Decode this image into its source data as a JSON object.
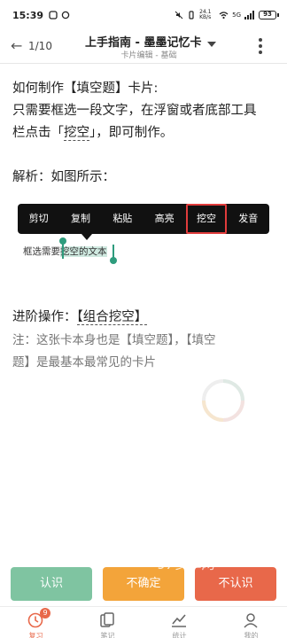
{
  "status_bar": {
    "time": "15:39",
    "net_speed": "24.1 KB/s",
    "network_type": "5G",
    "battery": "93"
  },
  "header": {
    "page_counter": "1/10",
    "title": "上手指南 - 墨墨记忆卡",
    "subtitle": "卡片编辑 - 基础",
    "back_icon": "back-arrow-icon",
    "more_icon": "more-vertical-icon"
  },
  "content": {
    "heading": "如何制作【填空题】卡片:",
    "line2": "只需要框选一段文字，在浮窗或者底部工具",
    "line3_pre": "栏点击「",
    "line3_link": "挖空",
    "line3_post": "」，即可制作。",
    "analysis": "解析：如图所示：",
    "context_menu": [
      "剪切",
      "复制",
      "粘贴",
      "高亮",
      "挖空",
      "发音"
    ],
    "highlighted_menu_item": "挖空",
    "selection_prefix": "框选需要",
    "selection_text": "挖空的文本",
    "advanced_pre": "进阶操作：",
    "advanced_link": "【组合挖空】",
    "note_line1": "注：这张卡本身也是【填空题】，【填空",
    "note_line2": "题】是最基本最常见的卡片"
  },
  "watermark": "97安卓网",
  "buttons": {
    "know": "认识",
    "unsure": "不确定",
    "unknown": "不认识"
  },
  "tabs": [
    {
      "label": "复习",
      "icon": "review-clock-icon",
      "badge": "9"
    },
    {
      "label": "笔记",
      "icon": "notes-cards-icon"
    },
    {
      "label": "统计",
      "icon": "stats-chart-icon"
    },
    {
      "label": "我的",
      "icon": "profile-person-icon"
    }
  ],
  "colors": {
    "know": "#7fc4a1",
    "unsure": "#f3a43a",
    "unknown": "#e8684a",
    "highlight_border": "#e03c3c",
    "selection": "#2e9c7d"
  }
}
